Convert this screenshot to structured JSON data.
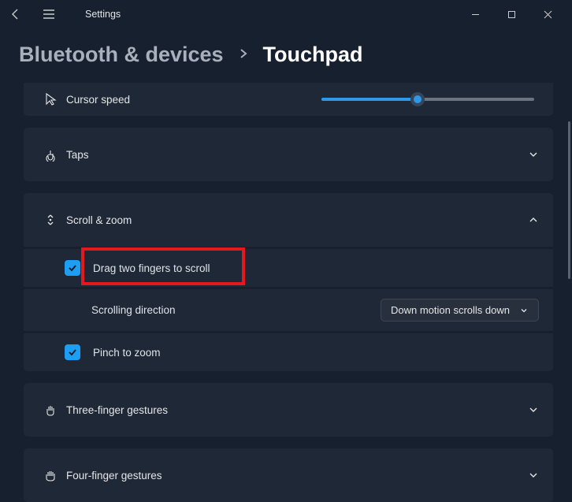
{
  "titlebar": {
    "app_title": "Settings"
  },
  "breadcrumb": {
    "parent": "Bluetooth & devices",
    "current": "Touchpad"
  },
  "rows": {
    "cursor_speed": "Cursor speed",
    "taps": "Taps",
    "scroll_zoom": "Scroll & zoom",
    "drag_two_fingers": "Drag two fingers to scroll",
    "scrolling_direction": "Scrolling direction",
    "scrolling_direction_value": "Down motion scrolls down",
    "pinch_to_zoom": "Pinch to zoom",
    "three_finger": "Three-finger gestures",
    "four_finger": "Four-finger gestures"
  },
  "slider": {
    "cursor_speed_value": 45
  },
  "checkboxes": {
    "drag_two_fingers": true,
    "pinch_to_zoom": true
  }
}
